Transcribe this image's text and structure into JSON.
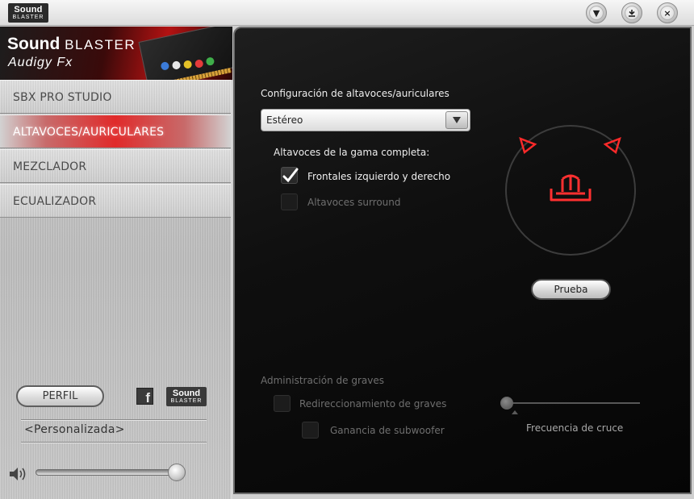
{
  "window": {
    "logo_line1": "Sound",
    "logo_line2": "BLASTER",
    "controls": [
      "minimize-to-tray",
      "minimize",
      "close"
    ]
  },
  "brand": {
    "name_bold": "Sound",
    "name_thin": "BLASTER",
    "model": "Audigy Fx"
  },
  "sidebar": {
    "items": [
      {
        "label": "SBX PRO STUDIO",
        "active": false
      },
      {
        "label": "ALTAVOCES/AURICULARES",
        "active": true
      },
      {
        "label": "MEZCLADOR",
        "active": false
      },
      {
        "label": "ECUALIZADOR",
        "active": false
      }
    ],
    "profile_button": "PERFIL",
    "facebook_icon": "facebook-icon",
    "mini_logo_line1": "Sound",
    "mini_logo_line2": "BLASTER",
    "preset": "<Personalizada>",
    "volume": 0.95
  },
  "main": {
    "speaker_config_label": "Configuración de altavoces/auriculares",
    "speaker_config_value": "Estéreo",
    "fullrange_label": "Altavoces de la gama completa:",
    "front_checkbox_label": "Frontales izquierdo y derecho",
    "front_checked": true,
    "surround_checkbox_label": "Altavoces surround",
    "surround_checked": false,
    "test_button": "Prueba",
    "bass_title": "Administración de graves",
    "bass_redirect_label": "Redireccionamiento de graves",
    "subwoofer_gain_label": "Ganancia de subwoofer",
    "crossover_label": "Frecuencia de cruce",
    "crossover_value": 0.0
  },
  "colors": {
    "accent_red": "#e02a2a",
    "speaker_red": "#ff2a2a",
    "panel_bg": "#0f0f0f"
  }
}
